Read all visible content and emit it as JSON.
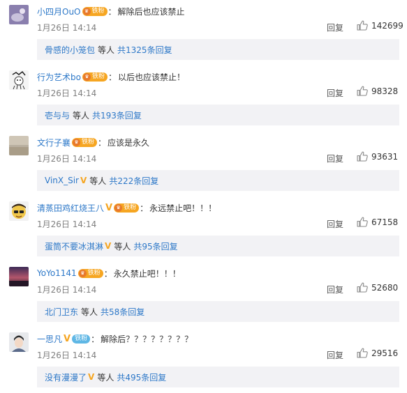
{
  "colors": {
    "link": "#2d78c8",
    "vip": "#f5a623",
    "fan_badge": "#f6a622",
    "reply_bg": "#f2f2f5"
  },
  "comments": [
    {
      "user": "小四月OuO",
      "vip": "",
      "fan": "铁粉",
      "colon": "：",
      "text": "解除后也应该禁止",
      "time": "1月26日 14:14",
      "reply": "回复",
      "likes": "142699",
      "sub_user": "骨感的小笼包",
      "sub_vip": "",
      "sub_etc": "等人",
      "sub_count": "共1325条回复"
    },
    {
      "user": "行为艺术bo",
      "vip": "",
      "fan": "铁粉",
      "colon": "：",
      "text": "以后也应该禁止！",
      "time": "1月26日 14:14",
      "reply": "回复",
      "likes": "98328",
      "sub_user": "壱与与",
      "sub_vip": "",
      "sub_etc": "等人",
      "sub_count": "共193条回复"
    },
    {
      "user": "文行子襄",
      "vip": "",
      "fan": "铁粉",
      "colon": "：",
      "text": "应该是永久",
      "time": "1月26日 14:14",
      "reply": "回复",
      "likes": "93631",
      "sub_user": "VinX_Sir",
      "sub_vip": "V",
      "sub_etc": "等人",
      "sub_count": "共222条回复"
    },
    {
      "user": "清蒸田鸡红烧王八",
      "vip": "V",
      "fan": "铁粉",
      "colon": "：",
      "text": "永远禁止吧！！！",
      "time": "1月26日 14:14",
      "reply": "回复",
      "likes": "67158",
      "sub_user": "蛋筒不要冰淇淋",
      "sub_vip": "V",
      "sub_etc": "等人",
      "sub_count": "共95条回复"
    },
    {
      "user": "YoYo1141",
      "vip": "",
      "fan": "铁粉",
      "colon": "：",
      "text": "永久禁止吧！！！",
      "time": "1月26日 14:14",
      "reply": "回复",
      "likes": "52680",
      "sub_user": "北门卫东",
      "sub_vip": "",
      "sub_etc": "等人",
      "sub_count": "共58条回复"
    },
    {
      "user": "一思凡",
      "vip": "V",
      "fan": "铁粉",
      "colon": "：",
      "text": "解除后？？？？？？？？",
      "time": "1月26日 14:14",
      "reply": "回复",
      "likes": "29516",
      "sub_user": "没有漫漫了",
      "sub_vip": "V",
      "sub_etc": "等人",
      "sub_count": "共495条回复"
    }
  ]
}
